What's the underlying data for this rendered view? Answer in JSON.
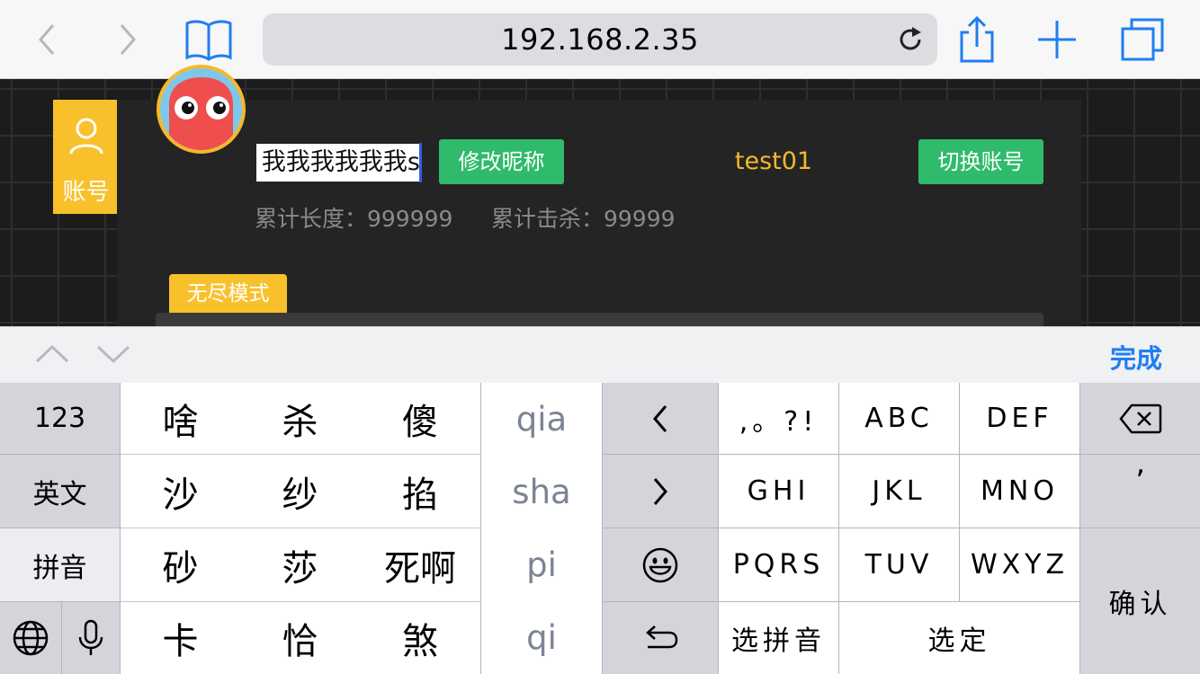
{
  "browser": {
    "url": "192.168.2.35",
    "back_icon": "chevron-left-icon",
    "forward_icon": "chevron-right-icon",
    "bookmarks_icon": "book-icon",
    "reload_icon": "reload-icon",
    "share_icon": "share-icon",
    "new_tab_icon": "plus-icon",
    "tabs_icon": "tabs-icon"
  },
  "game": {
    "side_tab": {
      "label": "账号",
      "icon": "user-icon"
    },
    "nickname_input_value": "我我我我我我s",
    "rename_button": "修改昵称",
    "account_name": "test01",
    "switch_account_button": "切换账号",
    "stats": {
      "total_length": "累计长度：999999",
      "total_kills": "累计击杀：99999"
    },
    "mode_tab": "无尽模式",
    "colors": {
      "accent_yellow": "#f8c12c",
      "button_green": "#2fbb6b",
      "panel": "#242424"
    }
  },
  "accessory_bar": {
    "done": "完成"
  },
  "keyboard": {
    "mode_keys": {
      "numbers": "123",
      "english": "英文",
      "pinyin": "拼音"
    },
    "candidates": [
      [
        "啥",
        "杀",
        "傻"
      ],
      [
        "沙",
        "纱",
        "掐"
      ],
      [
        "砂",
        "莎",
        "死啊"
      ],
      [
        "卡",
        "恰",
        "煞"
      ]
    ],
    "pinyin_options": [
      "qia",
      "sha",
      "pi",
      "qi"
    ],
    "t9_keys": [
      [
        ",。?!",
        "ABC",
        "DEF"
      ],
      [
        "GHI",
        "JKL",
        "MNO"
      ],
      [
        "PQRS",
        "TUV",
        "WXYZ"
      ]
    ],
    "select_pinyin": "选拼音",
    "select": "选定",
    "apostrophe": "’",
    "confirm": "确认"
  }
}
